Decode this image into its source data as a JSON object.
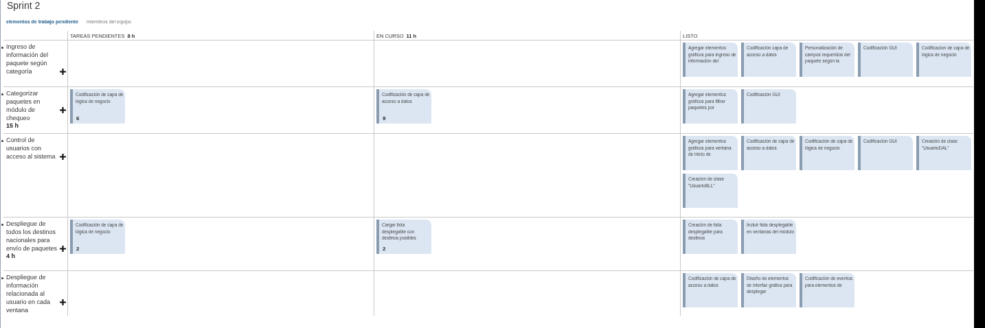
{
  "title": "Sprint 2",
  "tabs": [
    {
      "label": "elementos de trabajo pendiente",
      "selected": true
    },
    {
      "label": "miembros del equipo",
      "selected": false
    }
  ],
  "columns": [
    {
      "label": "TAREAS PENDIENTES",
      "hours": "8 h"
    },
    {
      "label": "EN CURSO",
      "hours": "11 h"
    },
    {
      "label": "LISTO"
    }
  ],
  "rows": [
    {
      "label": "Ingreso de información del paquete según categoría",
      "cells": [
        [],
        [],
        [
          {
            "title": "Agregar elementos gráficos para ingreso de información del"
          },
          {
            "title": "Codificación capa de acceso a datos"
          },
          {
            "title": "Personalización de campos requeridos del paquete según la"
          },
          {
            "title": "Codificación GUI"
          },
          {
            "title": "Codificacion de capa de lógica de negocio"
          }
        ]
      ]
    },
    {
      "label": "Categorizar paquetes en módulo de chequeo",
      "hours": "15 h",
      "cells": [
        [
          {
            "title": "Codificación de capa de lógica de negocio",
            "remaining": "6"
          }
        ],
        [
          {
            "title": "Codificación de capa de acceso a datos",
            "remaining": "9"
          }
        ],
        [
          {
            "title": "Agregar elementos gráficos para filtrar paquetes por"
          },
          {
            "title": "Codificación GUI"
          }
        ]
      ]
    },
    {
      "label": "Control de usuarios con acceso al sistema",
      "cells": [
        [],
        [],
        [
          {
            "title": "Agregar elementos gráficos para ventana de inicio de"
          },
          {
            "title": "Codificación de capa de acceso a datos"
          },
          {
            "title": "Codificación de capa de lógica de negocio"
          },
          {
            "title": "Codificación GUI"
          },
          {
            "title": "Creación de clase \"UsuarioDAL\""
          },
          {
            "title": "Creación de clase \"UsuarioBLL\""
          }
        ]
      ]
    },
    {
      "label": "Despliegue de todos los destinos nacionales para envío de paquetes",
      "hours": "4 h",
      "cells": [
        [
          {
            "title": "Codificación de capa de lógica de negocio",
            "remaining": "2"
          }
        ],
        [
          {
            "title": "Cargar lista desplegable con destinos posibles",
            "remaining": "2"
          }
        ],
        [
          {
            "title": "Creación de lista desplegable para destinos"
          },
          {
            "title": "Incluir lista desplegable en ventanas del módulo"
          }
        ]
      ]
    },
    {
      "label": "Despliegue de información relacionada al usuario en cada ventana",
      "cells": [
        [],
        [],
        [
          {
            "title": "Codificación de capa de acceso a datos"
          },
          {
            "title": "Diseño de elementos de interfaz gráfica para desplegar"
          },
          {
            "title": "Codificación de eventos para elementos de"
          }
        ]
      ]
    }
  ]
}
